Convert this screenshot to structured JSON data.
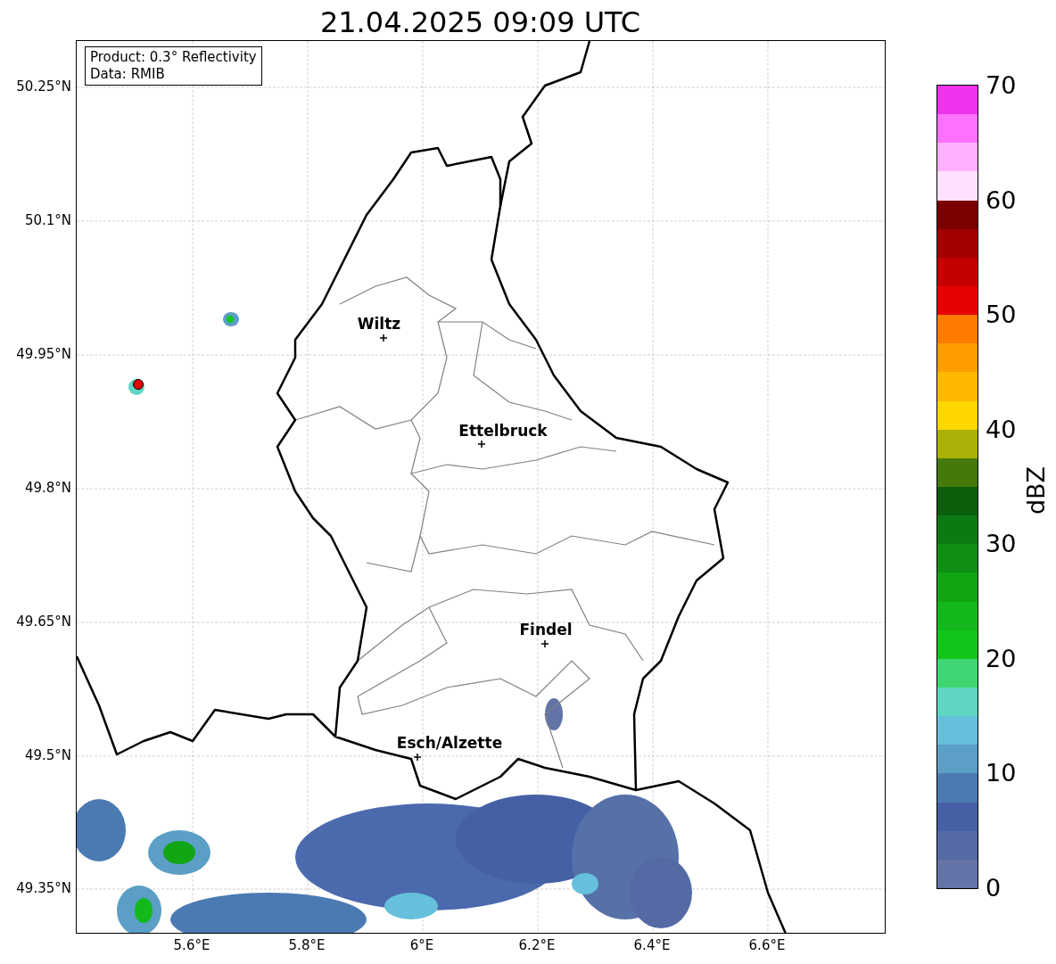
{
  "title": "21.04.2025 09:09 UTC",
  "legend": {
    "lines": [
      "Product: 0.3° Reflectivity",
      "Data: RMIB"
    ]
  },
  "cities": [
    {
      "name": "Wiltz"
    },
    {
      "name": "Ettelbruck"
    },
    {
      "name": "Findel"
    },
    {
      "name": "Esch/Alzette"
    }
  ],
  "lat_ticks": [
    "50.25°N",
    "50.1°N",
    "49.95°N",
    "49.8°N",
    "49.65°N",
    "49.5°N",
    "49.35°N"
  ],
  "lon_ticks": [
    "5.6°E",
    "5.8°E",
    "6°E",
    "6.2°E",
    "6.4°E",
    "6.6°E"
  ],
  "colorbar": {
    "label": "dBZ",
    "ticks": [
      "70",
      "60",
      "50",
      "40",
      "30",
      "20",
      "10",
      "0"
    ],
    "segments": [
      {
        "color": "#ee33ee"
      },
      {
        "color": "#ff70ff"
      },
      {
        "color": "#ffb0ff"
      },
      {
        "color": "#ffe0ff"
      },
      {
        "color": "#7a0000"
      },
      {
        "color": "#a00000"
      },
      {
        "color": "#c40000"
      },
      {
        "color": "#e60000"
      },
      {
        "color": "#ff7b00"
      },
      {
        "color": "#ff9c00"
      },
      {
        "color": "#ffb800"
      },
      {
        "color": "#ffd600"
      },
      {
        "color": "#aab00a"
      },
      {
        "color": "#457a0a"
      },
      {
        "color": "#0a5e0c"
      },
      {
        "color": "#0c7a12"
      },
      {
        "color": "#0f8f14"
      },
      {
        "color": "#12a514"
      },
      {
        "color": "#13b81a"
      },
      {
        "color": "#12c61a"
      },
      {
        "color": "#3fd673"
      },
      {
        "color": "#5fd6c4"
      },
      {
        "color": "#66c0dc"
      },
      {
        "color": "#5b9ec6"
      },
      {
        "color": "#4b7ab2"
      },
      {
        "color": "#4560a5"
      },
      {
        "color": "#556aa5"
      },
      {
        "color": "#6474a8"
      }
    ]
  }
}
